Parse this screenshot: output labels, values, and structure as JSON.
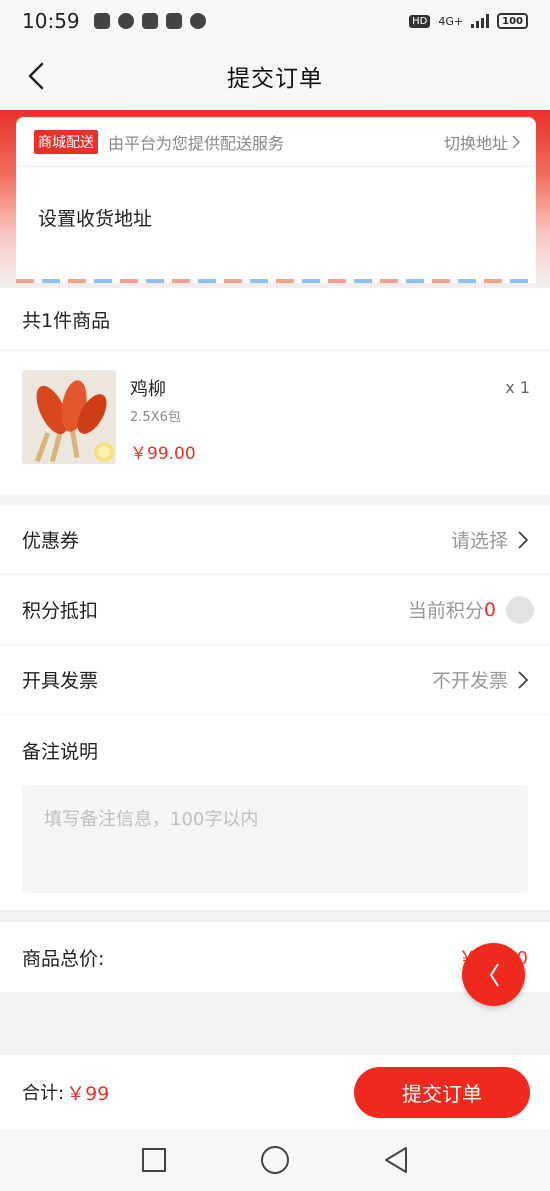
{
  "status_bar": {
    "time": "10:59",
    "hd": "HD",
    "network": "4G+",
    "battery": "100"
  },
  "header": {
    "title": "提交订单"
  },
  "address": {
    "tag": "商城配送",
    "description": "由平台为您提供配送服务",
    "switch_label": "切换地址",
    "placeholder": "设置收货地址"
  },
  "goods": {
    "count_label": "共1件商品",
    "items": [
      {
        "name": "鸡柳",
        "spec": "2.5X6包",
        "price": "￥99.00",
        "quantity": "x 1"
      }
    ]
  },
  "options": {
    "coupon_label": "优惠券",
    "coupon_value": "请选择",
    "points_label": "积分抵扣",
    "points_prefix": "当前积分",
    "points_value": "0",
    "invoice_label": "开具发票",
    "invoice_value": "不开发票",
    "remark_label": "备注说明",
    "remark_placeholder": "填写备注信息，100字以内"
  },
  "summary": {
    "total_label": "商品总价:",
    "total_value": "￥99.00"
  },
  "bottom": {
    "sum_label": "合计:",
    "sum_value": "￥99",
    "submit_label": "提交订单"
  },
  "colors": {
    "accent": "#e8312b",
    "button": "#f0291e"
  }
}
